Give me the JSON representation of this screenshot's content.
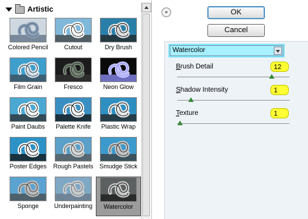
{
  "gallery": {
    "title": "Artistic",
    "filters": [
      {
        "label": "Colored Pencil",
        "icon": "colored-pencil-thumbnail"
      },
      {
        "label": "Cutout",
        "icon": "cutout-thumbnail"
      },
      {
        "label": "Dry Brush",
        "icon": "dry-brush-thumbnail"
      },
      {
        "label": "Film Grain",
        "icon": "film-grain-thumbnail"
      },
      {
        "label": "Fresco",
        "icon": "fresco-thumbnail"
      },
      {
        "label": "Neon Glow",
        "icon": "neon-glow-thumbnail"
      },
      {
        "label": "Paint Daubs",
        "icon": "paint-daubs-thumbnail"
      },
      {
        "label": "Palette Knife",
        "icon": "palette-knife-thumbnail"
      },
      {
        "label": "Plastic Wrap",
        "icon": "plastic-wrap-thumbnail"
      },
      {
        "label": "Poster Edges",
        "icon": "poster-edges-thumbnail"
      },
      {
        "label": "Rough Pastels",
        "icon": "rough-pastels-thumbnail"
      },
      {
        "label": "Smudge Stick",
        "icon": "smudge-stick-thumbnail"
      },
      {
        "label": "Sponge",
        "icon": "sponge-thumbnail"
      },
      {
        "label": "Underpainting",
        "icon": "underpainting-thumbnail"
      },
      {
        "label": "Watercolor",
        "icon": "watercolor-thumbnail",
        "selected": true
      }
    ]
  },
  "buttons": {
    "ok": "OK",
    "cancel": "Cancel"
  },
  "settings": {
    "filter_select": "Watercolor",
    "params": [
      {
        "label_underline": "B",
        "label_rest": "rush Detail",
        "value": "12",
        "slider_fraction": 0.857
      },
      {
        "label_underline": "S",
        "label_rest": "hadow Intensity",
        "value": "1",
        "slider_fraction": 0.1
      },
      {
        "label_underline": "T",
        "label_rest": "exture",
        "value": "1",
        "slider_fraction": 0.0
      }
    ]
  },
  "colors": {
    "highlight_yellow": "#ffff33",
    "dropdown_cyan": "#a6f0ff",
    "thumb_sky": "#3a9fcf",
    "selected_bg": "#9c9c9c"
  }
}
